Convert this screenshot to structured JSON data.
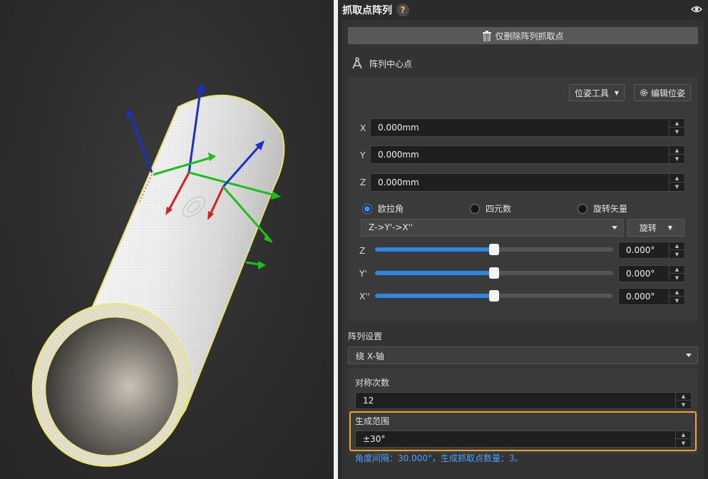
{
  "panel": {
    "title": "抓取点阵列",
    "help": "?",
    "delete_button": "仅删除阵列抓取点",
    "array_center_label": "阵列中心点",
    "pose_tool_button": "位姿工具",
    "edit_pose_button": "编辑位姿",
    "position": [
      {
        "axis": "X",
        "value": "0.000mm"
      },
      {
        "axis": "Y",
        "value": "0.000mm"
      },
      {
        "axis": "Z",
        "value": "0.000mm"
      }
    ],
    "rotation_modes": [
      {
        "label": "欧拉角",
        "selected": true
      },
      {
        "label": "四元数",
        "selected": false
      },
      {
        "label": "旋转矢量",
        "selected": false
      }
    ],
    "euler_order": "Z->Y'->X''",
    "rotate_button": "旋转",
    "angles": [
      {
        "axis": "Z",
        "value": "0.000°",
        "slider_fraction": 0.5
      },
      {
        "axis": "Y'",
        "value": "0.000°",
        "slider_fraction": 0.5
      },
      {
        "axis": "X''",
        "value": "0.000°",
        "slider_fraction": 0.5
      }
    ],
    "array_settings_label": "阵列设置",
    "array_axis": "绕 X-轴",
    "symmetry_count_label": "对称次数",
    "symmetry_count": "12",
    "range_label": "生成范围",
    "range_value": "±30°",
    "info": "角度间隔：30.000°，生成抓取点数量：3。"
  },
  "colors": {
    "accent_blue": "#2f86e0",
    "highlight_orange": "#f0a22a",
    "info_blue": "#4aa3ff",
    "axis_x_red": "#d42020",
    "axis_y_green": "#18c018",
    "axis_z_blue": "#1a2fd0"
  }
}
